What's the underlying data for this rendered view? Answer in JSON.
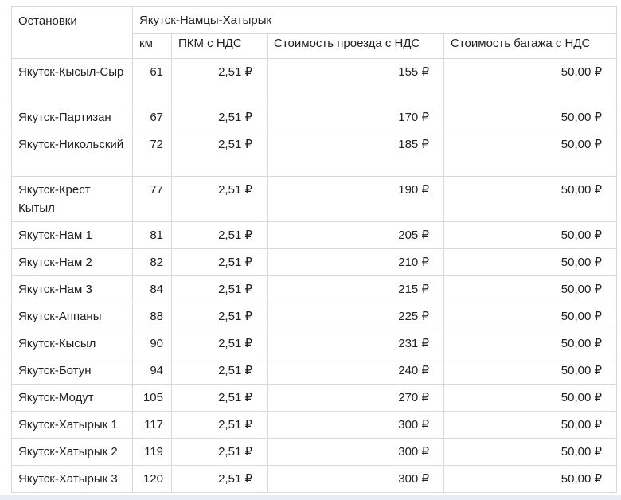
{
  "header": {
    "stops_label": "Остановки",
    "route_label": "Якутск-Намцы-Хатырык",
    "col_km": "км",
    "col_pkm": "ПКМ с НДС",
    "col_fare": "Стоимость проезда с НДС",
    "col_baggage": "Стоимость багажа с НДС"
  },
  "rows": [
    {
      "stop": "Якутск-Кысыл-Сыр",
      "km": "61",
      "pkm": "2,51 ₽",
      "fare": "155 ₽",
      "baggage": "50,00 ₽"
    },
    {
      "stop": "Якутск-Партизан",
      "km": "67",
      "pkm": "2,51 ₽",
      "fare": "170 ₽",
      "baggage": "50,00 ₽"
    },
    {
      "stop": "Якутск-Никольский",
      "km": "72",
      "pkm": "2,51 ₽",
      "fare": "185 ₽",
      "baggage": "50,00 ₽"
    },
    {
      "stop": "Якутск-Крест Кытыл",
      "km": "77",
      "pkm": "2,51 ₽",
      "fare": "190 ₽",
      "baggage": "50,00 ₽"
    },
    {
      "stop": "Якутск-Нам 1",
      "km": "81",
      "pkm": "2,51 ₽",
      "fare": "205 ₽",
      "baggage": "50,00 ₽"
    },
    {
      "stop": "Якутск-Нам 2",
      "km": "82",
      "pkm": "2,51 ₽",
      "fare": "210 ₽",
      "baggage": "50,00 ₽"
    },
    {
      "stop": "Якутск-Нам 3",
      "km": "84",
      "pkm": "2,51 ₽",
      "fare": "215 ₽",
      "baggage": "50,00 ₽"
    },
    {
      "stop": "Якутск-Аппаны",
      "km": "88",
      "pkm": "2,51 ₽",
      "fare": "225 ₽",
      "baggage": "50,00 ₽"
    },
    {
      "stop": "Якутск-Кысыл",
      "km": "90",
      "pkm": "2,51 ₽",
      "fare": "231 ₽",
      "baggage": "50,00 ₽"
    },
    {
      "stop": "Якутск-Ботун",
      "km": "94",
      "pkm": "2,51 ₽",
      "fare": "240 ₽",
      "baggage": "50,00 ₽"
    },
    {
      "stop": "Якутск-Модут",
      "km": "105",
      "pkm": "2,51 ₽",
      "fare": "270 ₽",
      "baggage": "50,00 ₽"
    },
    {
      "stop": "Якутск-Хатырык 1",
      "km": "117",
      "pkm": "2,51 ₽",
      "fare": "300 ₽",
      "baggage": "50,00 ₽"
    },
    {
      "stop": "Якутск-Хатырык 2",
      "km": "119",
      "pkm": "2,51 ₽",
      "fare": "300 ₽",
      "baggage": "50,00 ₽"
    },
    {
      "stop": "Якутск-Хатырык 3",
      "km": "120",
      "pkm": "2,51 ₽",
      "fare": "300 ₽",
      "baggage": "50,00 ₽"
    }
  ]
}
